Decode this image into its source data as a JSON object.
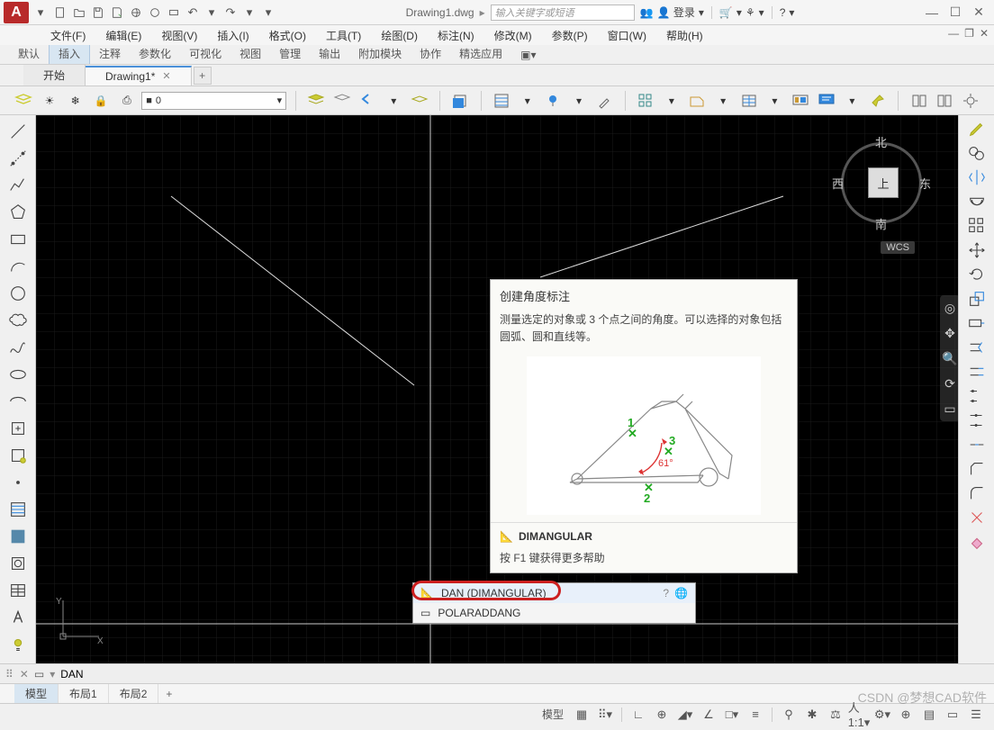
{
  "app": {
    "name": "AutoCAD",
    "filename": "Drawing1.dwg",
    "search_placeholder": "输入关键字或短语",
    "login": "登录"
  },
  "menus": [
    "文件(F)",
    "编辑(E)",
    "视图(V)",
    "插入(I)",
    "格式(O)",
    "工具(T)",
    "绘图(D)",
    "标注(N)",
    "修改(M)",
    "参数(P)",
    "窗口(W)",
    "帮助(H)"
  ],
  "ribbon_tabs": [
    "默认",
    "插入",
    "注释",
    "参数化",
    "可视化",
    "视图",
    "管理",
    "输出",
    "附加模块",
    "协作",
    "精选应用"
  ],
  "ribbon_active": 1,
  "file_tabs": [
    {
      "label": "开始",
      "active": false,
      "closable": false
    },
    {
      "label": "Drawing1*",
      "active": true,
      "closable": true
    }
  ],
  "layer_combo_value": "0",
  "viewcube": {
    "n": "北",
    "s": "南",
    "e": "东",
    "w": "西",
    "face": "上",
    "wcs": "WCS"
  },
  "tooltip": {
    "title": "创建角度标注",
    "desc": "测量选定的对象或 3 个点之间的角度。可以选择的对象包括圆弧、圆和直线等。",
    "command": "DIMANGULAR",
    "help": "按 F1 键获得更多帮助",
    "diagram": {
      "pt1": "1",
      "pt2": "2",
      "pt3": "3",
      "angle": "61°"
    }
  },
  "suggestions": [
    {
      "label": "DAN (DIMANGULAR)",
      "highlighted": true,
      "circled": true
    },
    {
      "label": "POLARADDANG",
      "highlighted": false,
      "circled": false
    }
  ],
  "commandline": {
    "prompt_icon": "▸",
    "typed": "DAN"
  },
  "model_tabs": [
    "模型",
    "布局1",
    "布局2"
  ],
  "model_active": 0,
  "status": {
    "model_label": "模型"
  },
  "watermark": "CSDN @梦想CAD软件"
}
